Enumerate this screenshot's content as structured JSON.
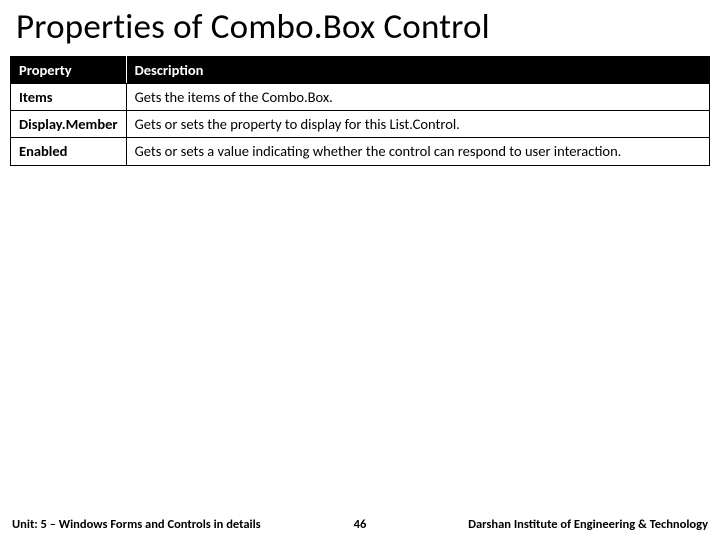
{
  "title": "Properties of Combo.Box Control",
  "headers": {
    "col1": "Property",
    "col2": "Description"
  },
  "rows": [
    {
      "prop": "Items",
      "desc": "Gets the items of the Combo.Box."
    },
    {
      "prop": "Display.Member",
      "desc": "Gets or sets the property to display for this List.Control."
    },
    {
      "prop": "Enabled",
      "desc": "Gets or sets a value indicating whether the control can respond to user interaction."
    }
  ],
  "footer": {
    "unit": "Unit: 5 – Windows Forms and Controls in details",
    "page": "46",
    "institution": "Darshan Institute of Engineering & Technology"
  }
}
